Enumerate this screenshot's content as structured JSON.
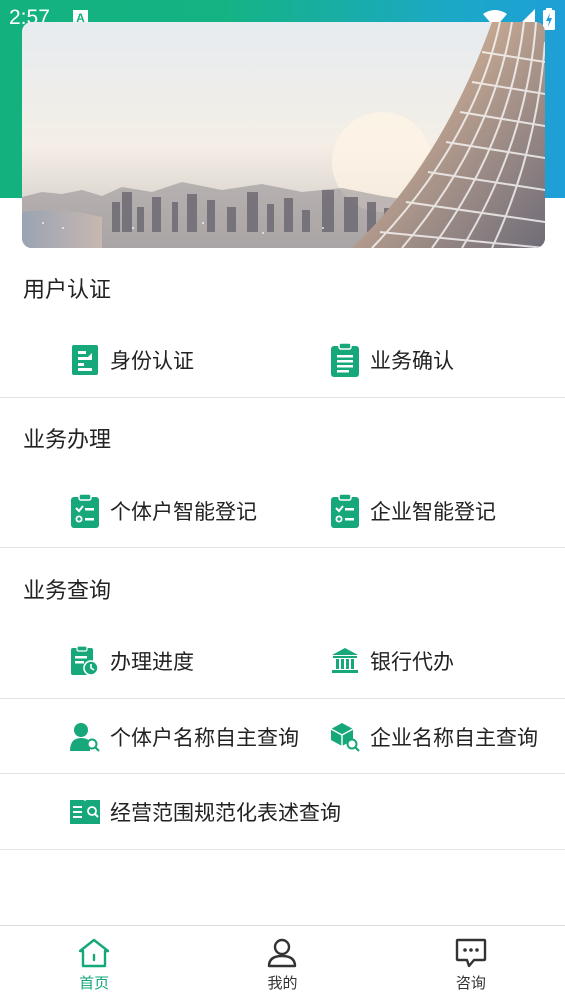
{
  "status_bar": {
    "time": "2:57",
    "notification_icon": "A"
  },
  "sections": {
    "user_auth": {
      "title": "用户认证",
      "items": [
        {
          "label": "身份认证",
          "icon": "id-card-icon"
        },
        {
          "label": "业务确认",
          "icon": "clipboard-list-icon"
        }
      ]
    },
    "business_handle": {
      "title": "业务办理",
      "items": [
        {
          "label": "个体户智能登记",
          "icon": "checklist-icon"
        },
        {
          "label": "企业智能登记",
          "icon": "checklist-icon"
        }
      ]
    },
    "business_query": {
      "title": "业务查询",
      "items": [
        {
          "label": "办理进度",
          "icon": "progress-clock-icon"
        },
        {
          "label": "银行代办",
          "icon": "bank-icon"
        },
        {
          "label": "个体户名称自主查询",
          "icon": "user-search-icon"
        },
        {
          "label": "企业名称自主查询",
          "icon": "box-search-icon"
        },
        {
          "label": "经营范围规范化表述查询",
          "icon": "book-search-icon"
        }
      ]
    }
  },
  "bottom_nav": [
    {
      "label": "首页",
      "icon": "home-icon",
      "active": true
    },
    {
      "label": "我的",
      "icon": "user-icon",
      "active": false
    },
    {
      "label": "咨询",
      "icon": "chat-icon",
      "active": false
    }
  ],
  "colors": {
    "brand_green": "#13b17e",
    "brand_blue": "#1e9fd8",
    "icon_green": "#16a77a",
    "active_nav": "#13a77a"
  }
}
